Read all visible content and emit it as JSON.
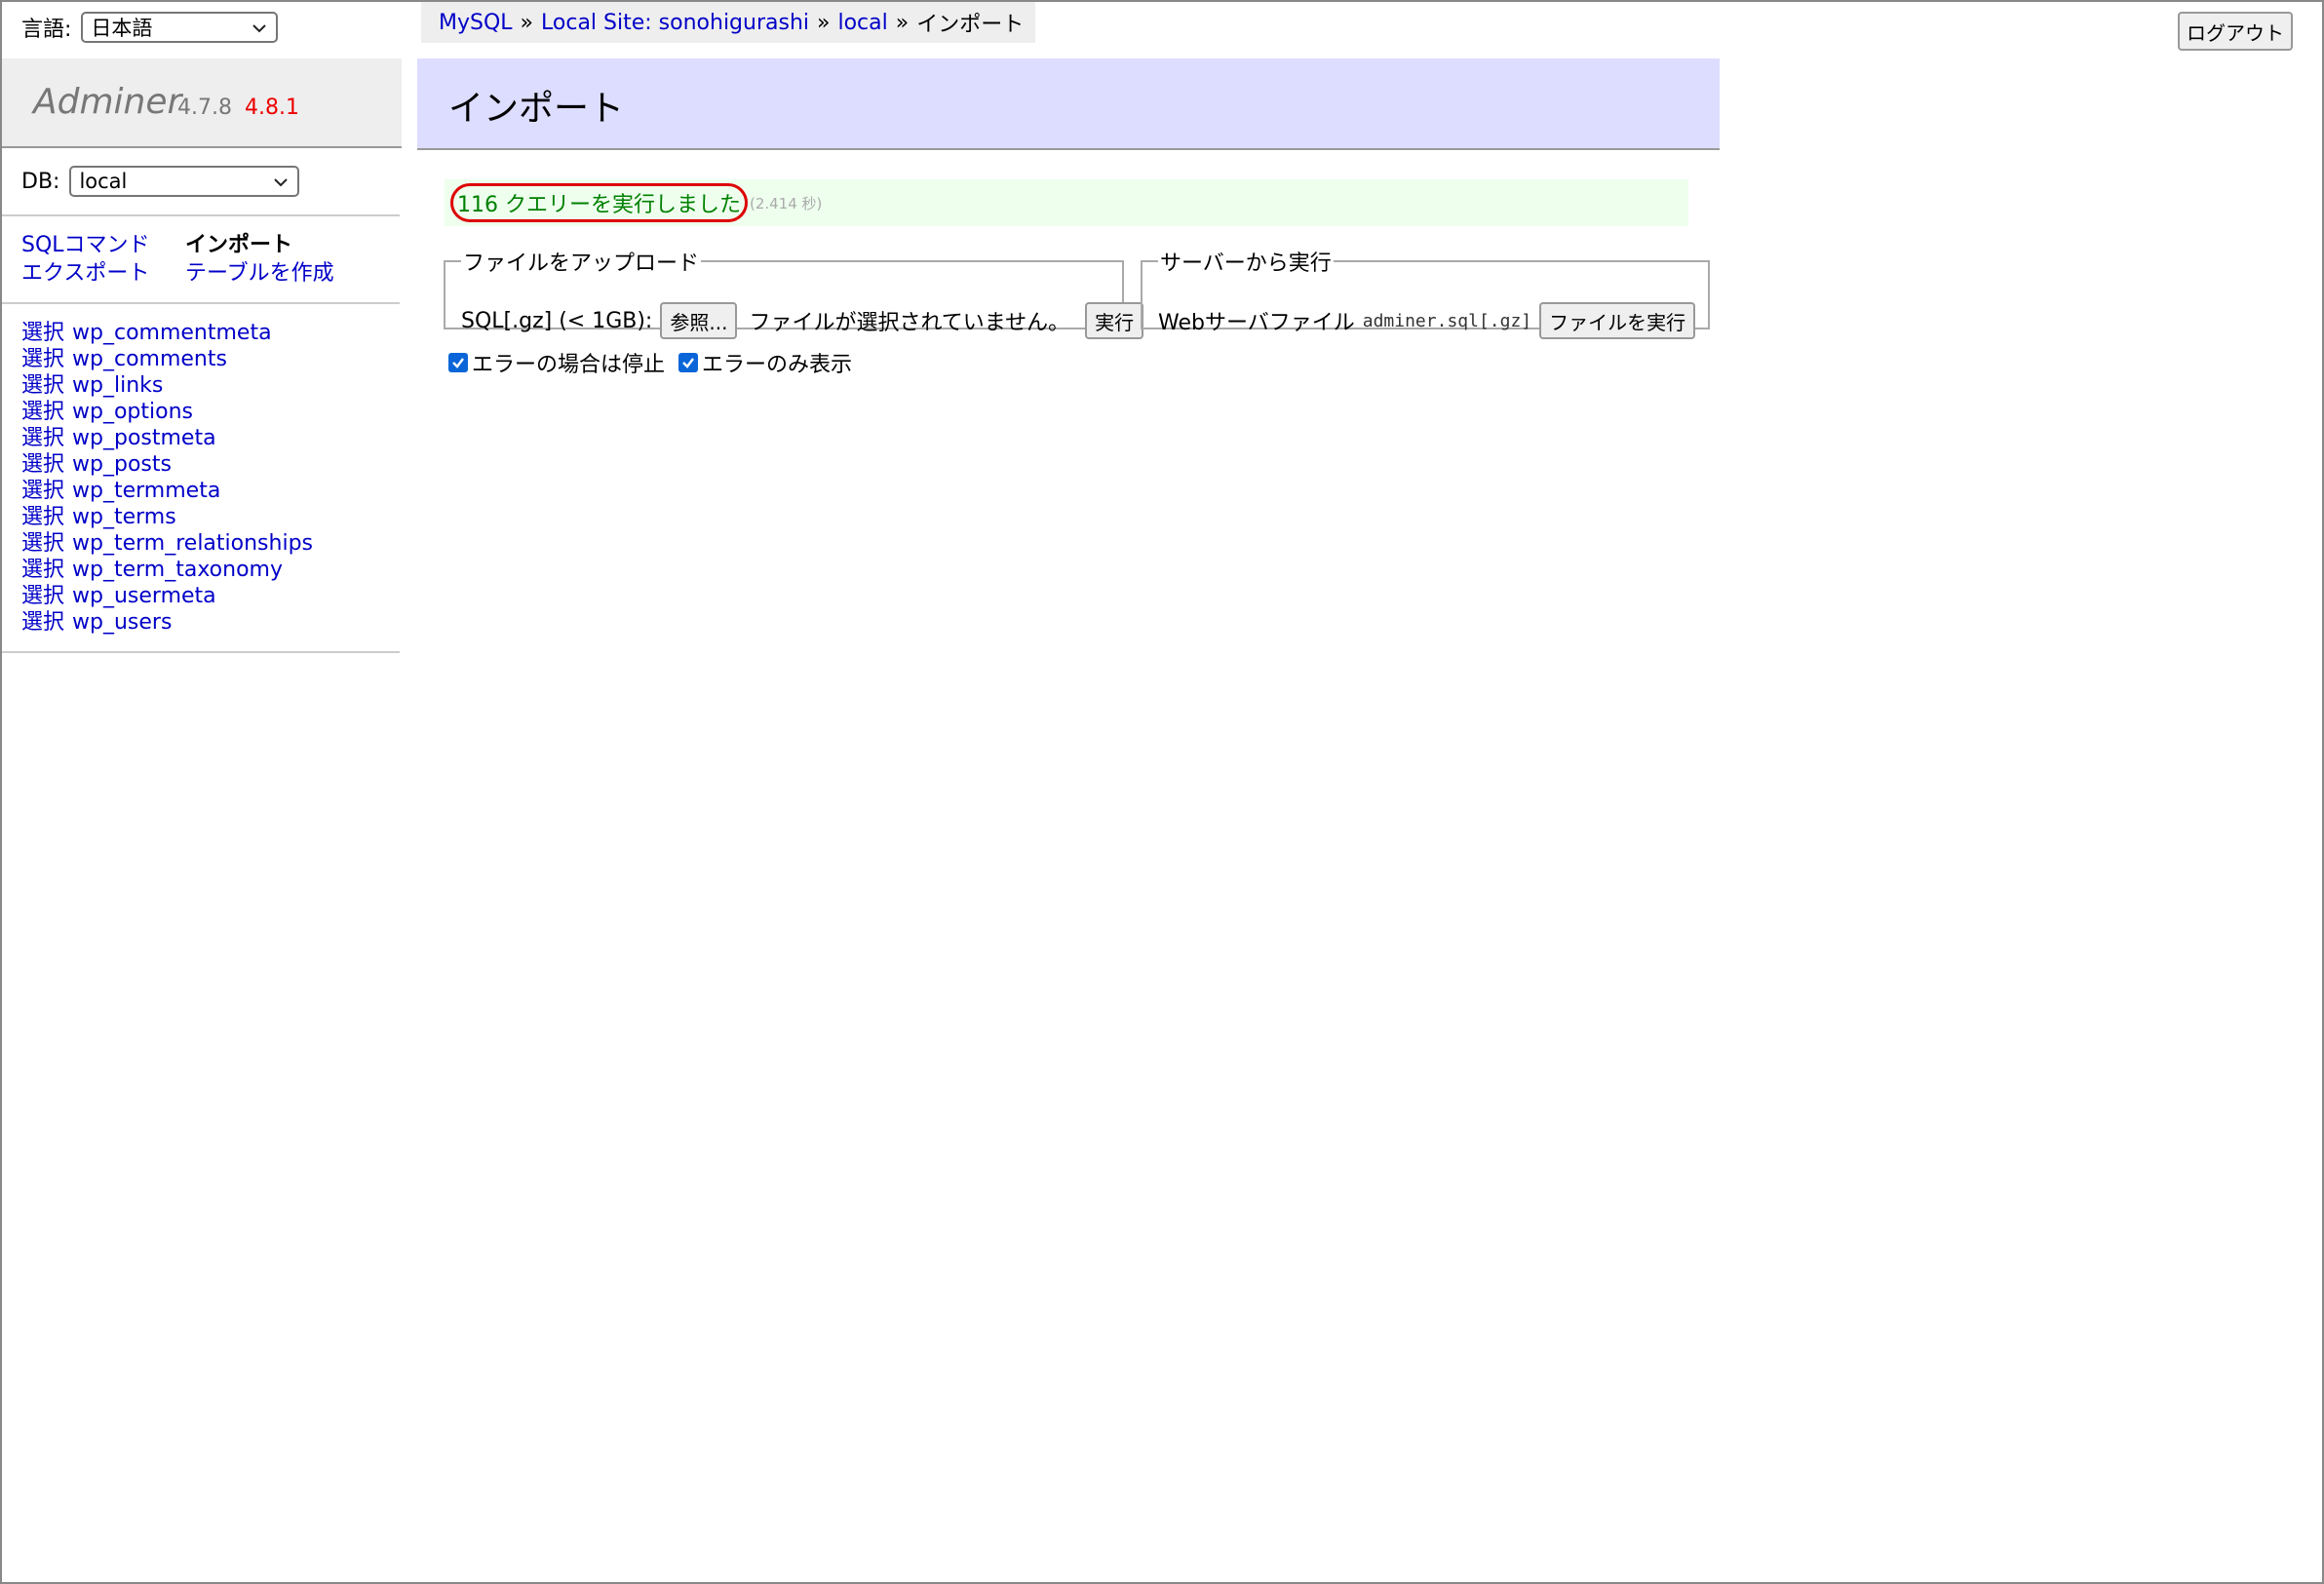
{
  "language": {
    "label": "言語:",
    "selected": "日本語"
  },
  "logo": {
    "name": "Adminer",
    "version": "4.7.8",
    "new_version": "4.8.1"
  },
  "db": {
    "label": "DB:",
    "selected": "local"
  },
  "commands": {
    "sql": "SQLコマンド",
    "import": "インポート",
    "export": "エクスポート",
    "create_table": "テーブルを作成"
  },
  "tables": {
    "select_label": "選択",
    "items": [
      "wp_commentmeta",
      "wp_comments",
      "wp_links",
      "wp_options",
      "wp_postmeta",
      "wp_posts",
      "wp_termmeta",
      "wp_terms",
      "wp_term_relationships",
      "wp_term_taxonomy",
      "wp_usermeta",
      "wp_users"
    ]
  },
  "breadcrumb": {
    "items": [
      "MySQL",
      "Local Site: sonohigurashi",
      "local"
    ],
    "current": "インポート",
    "separator": "»"
  },
  "header": {
    "logout": "ログアウト",
    "title": "インポート"
  },
  "message": {
    "text": "116 クエリーを実行しました",
    "time": "(2.414 秒)"
  },
  "upload": {
    "legend": "ファイルをアップロード",
    "label": "SQL[.gz] (< 1GB):",
    "browse": "参照...",
    "no_file": "ファイルが選択されていません。",
    "execute": "実行"
  },
  "server": {
    "legend": "サーバーから実行",
    "label": "Webサーバファイル",
    "filename": "adminer.sql[.gz]",
    "execute": "ファイルを実行"
  },
  "options": {
    "stop_on_error": "エラーの場合は停止",
    "errors_only": "エラーのみ表示",
    "stop_on_error_checked": true,
    "errors_only_checked": true
  },
  "colors": {
    "link": "#0000c8",
    "title_bg": "#ddddff",
    "message_bg": "#eeffee",
    "message_text": "#008000",
    "highlight_oval": "#dd0000",
    "checkbox": "#0a66d8",
    "new_version": "#ee0000"
  }
}
